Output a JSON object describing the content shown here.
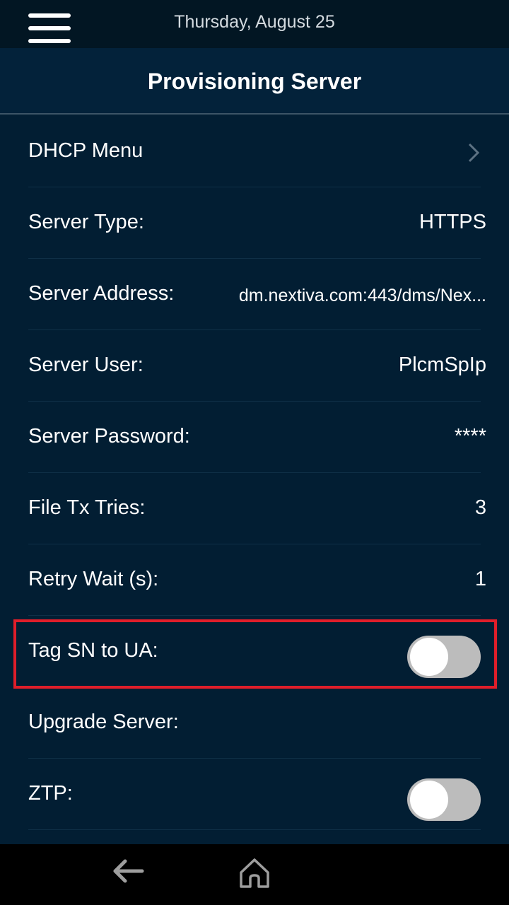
{
  "status_bar": {
    "date": "Thursday, August 25"
  },
  "header": {
    "title": "Provisioning Server"
  },
  "rows": [
    {
      "label": "DHCP Menu",
      "type": "link",
      "icon": "chevron-right-icon"
    },
    {
      "label": "Server Type:",
      "value": "HTTPS"
    },
    {
      "label": "Server Address:",
      "value": "dm.nextiva.com:443/dms/Nex..."
    },
    {
      "label": "Server User:",
      "value": "PlcmSpIp"
    },
    {
      "label": "Server Password:",
      "value": "****"
    },
    {
      "label": "File Tx Tries:",
      "value": "3"
    },
    {
      "label": "Retry Wait (s):",
      "value": "1"
    },
    {
      "label": "Tag SN to UA:",
      "type": "toggle",
      "checked": false,
      "highlighted": true
    },
    {
      "label": "Upgrade Server:",
      "value": ""
    },
    {
      "label": "ZTP:",
      "type": "toggle",
      "checked": false
    }
  ],
  "nav_bar": {
    "back_icon": "back-arrow-icon",
    "home_icon": "home-icon"
  },
  "colors": {
    "background": "#021e33",
    "status_bar": "#021623",
    "highlight": "#e01e2a",
    "toggle_off": "#bcbcbc"
  }
}
